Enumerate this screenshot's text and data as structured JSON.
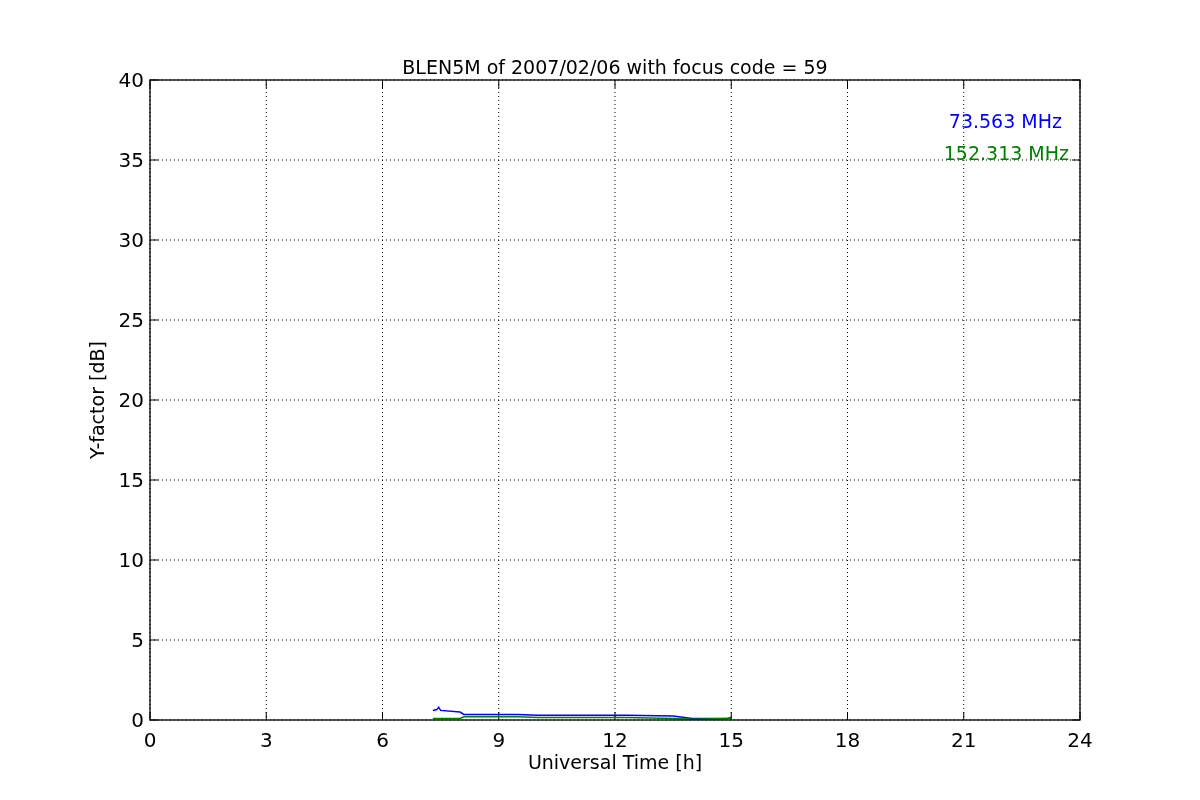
{
  "chart_data": {
    "type": "line",
    "title": "BLEN5M of 2007/02/06 with focus code = 59",
    "xlabel": "Universal Time [h]",
    "ylabel": "Y-factor [dB]",
    "x": [
      7.3,
      7.4,
      7.45,
      7.5,
      8.0,
      8.1,
      8.4,
      9.5,
      10.0,
      10.9,
      12.3,
      13.5,
      14.0,
      14.9,
      15.0
    ],
    "series": [
      {
        "name": "73.563 MHz",
        "color": "#0000ff",
        "values": [
          0.6,
          0.65,
          0.8,
          0.6,
          0.5,
          0.35,
          0.35,
          0.35,
          0.3,
          0.3,
          0.3,
          0.25,
          0.1,
          0.1,
          0.15
        ]
      },
      {
        "name": "152.313 MHz",
        "color": "#008000",
        "values": [
          0.1,
          0.1,
          0.1,
          0.1,
          0.1,
          0.2,
          0.2,
          0.2,
          0.15,
          0.15,
          0.15,
          0.1,
          0.05,
          0.1,
          0.1
        ]
      }
    ],
    "grid": true,
    "xlim": [
      0,
      24
    ],
    "ylim": [
      0,
      40
    ],
    "xticks": [
      0,
      3,
      6,
      9,
      12,
      15,
      18,
      21,
      24
    ],
    "yticks": [
      0,
      5,
      10,
      15,
      20,
      25,
      30,
      35,
      40
    ]
  }
}
